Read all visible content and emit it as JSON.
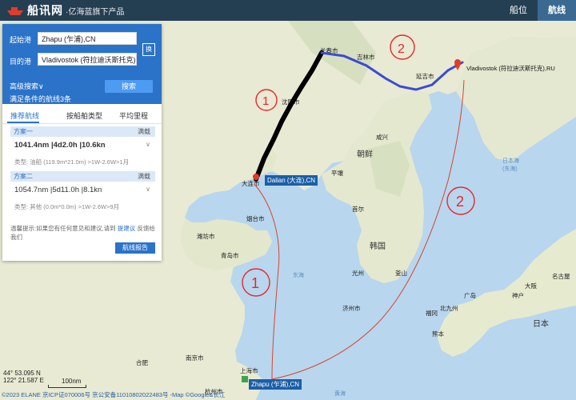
{
  "app": {
    "logo_text": "船讯网",
    "logo_sub": "·亿海蓝旗下产品",
    "nav": [
      {
        "label": "船位"
      },
      {
        "label": "航线"
      }
    ]
  },
  "panel": {
    "origin_label": "起始港",
    "origin_value": "Zhapu (乍浦),CN",
    "dest_label": "目的港",
    "dest_value": "Vladivostok (符拉迪沃斯托克),RU",
    "swap_label": "换",
    "advanced_label": "高级搜索∨",
    "search_label": "搜索",
    "result_text": "满足条件的航线3条",
    "tabs": [
      {
        "label": "推荐航线"
      },
      {
        "label": "按船舶类型"
      },
      {
        "label": "平均里程"
      }
    ],
    "plans": [
      {
        "label": "方案一",
        "status": "满载",
        "summary": "1041.4nm  |4d2.0h  |10.6kn",
        "detail": "类型: 油船 (119.9m*21.0m)  >1W-2.6W>1月"
      },
      {
        "label": "方案二",
        "status": "满载",
        "summary": "1054.7nm  |5d11.0h  |8.1kn",
        "detail": "类型: 其他 (0.0m*0.0m)  >1W-2.6W>9月"
      }
    ],
    "tip_text": "温馨提示:如果您有任何意见和建议,请到",
    "tip_link": "提建议",
    "tip_end": "反馈给我们",
    "report_label": "航线报告"
  },
  "map": {
    "sea_labels": [
      {
        "name": "sea-east-china",
        "text": "东海"
      },
      {
        "name": "sea-japan",
        "text": "日本海"
      },
      {
        "name": "sea-japan-cn",
        "text": "(东海)"
      },
      {
        "name": "sea-yellow",
        "text": "黄海"
      }
    ],
    "country_labels": [
      {
        "name": "korea-north",
        "text": "朝鲜"
      },
      {
        "name": "korea-south",
        "text": "韩国"
      },
      {
        "name": "japan",
        "text": "日本"
      }
    ],
    "city_labels": [
      {
        "name": "changchun",
        "text": "长春市"
      },
      {
        "name": "jilin",
        "text": "吉林市"
      },
      {
        "name": "shenyang",
        "text": "沈阳市"
      },
      {
        "name": "dalian",
        "text": "大连市"
      },
      {
        "name": "yantai",
        "text": "烟台市"
      },
      {
        "name": "weifang",
        "text": "潍坊市"
      },
      {
        "name": "qingdao",
        "text": "青岛市"
      },
      {
        "name": "pyongyang",
        "text": "平壤"
      },
      {
        "name": "seoul",
        "text": "首尔"
      },
      {
        "name": "busan",
        "text": "釜山"
      },
      {
        "name": "fukuoka",
        "text": "福冈"
      },
      {
        "name": "kitakyushu",
        "text": "北九州"
      },
      {
        "name": "kumamoto",
        "text": "熊本"
      },
      {
        "name": "hiroshima",
        "text": "广岛"
      },
      {
        "name": "osaka",
        "text": "大阪"
      },
      {
        "name": "nagoya",
        "text": "名古屋"
      },
      {
        "name": "kobe",
        "text": "神户"
      },
      {
        "name": "shanghai",
        "text": "上海市"
      },
      {
        "name": "hangzhou",
        "text": "杭州市"
      },
      {
        "name": "nanjing",
        "text": "南京市"
      },
      {
        "name": "hefei",
        "text": "合肥"
      },
      {
        "name": "jeju",
        "text": "济州市"
      },
      {
        "name": "gwangju",
        "text": "光州"
      },
      {
        "name": "hamhung",
        "text": "咸兴"
      },
      {
        "name": "yanji",
        "text": "延吉市"
      }
    ],
    "ports": {
      "dalian": "Dalian (大连),CN",
      "vladivostok": "Vladivostok (符拉迪沃斯托克),RU",
      "zhapu": "Zhapu (乍浦),CN"
    },
    "annotations": [
      {
        "name": "annotation-1-north",
        "text": "1"
      },
      {
        "name": "annotation-2-north",
        "text": "2"
      },
      {
        "name": "annotation-1-south",
        "text": "1"
      },
      {
        "name": "annotation-2-south",
        "text": "2"
      }
    ],
    "coord_lat": "44° 53.095 N",
    "coord_lon": "122° 21.587 E",
    "scale_label": "100nm",
    "copyright": "©2023 ELANE 京ICP证070006号  京公安备11010802022483号  -Map ©Google&长江"
  },
  "colors": {
    "topbar": "#253f52",
    "panel_header": "#2a73c9",
    "route_land_black": "#000000",
    "route_land_blue": "#3c4bd0",
    "route_sea_red": "#d9442e",
    "annotation_red": "#e8262b"
  }
}
